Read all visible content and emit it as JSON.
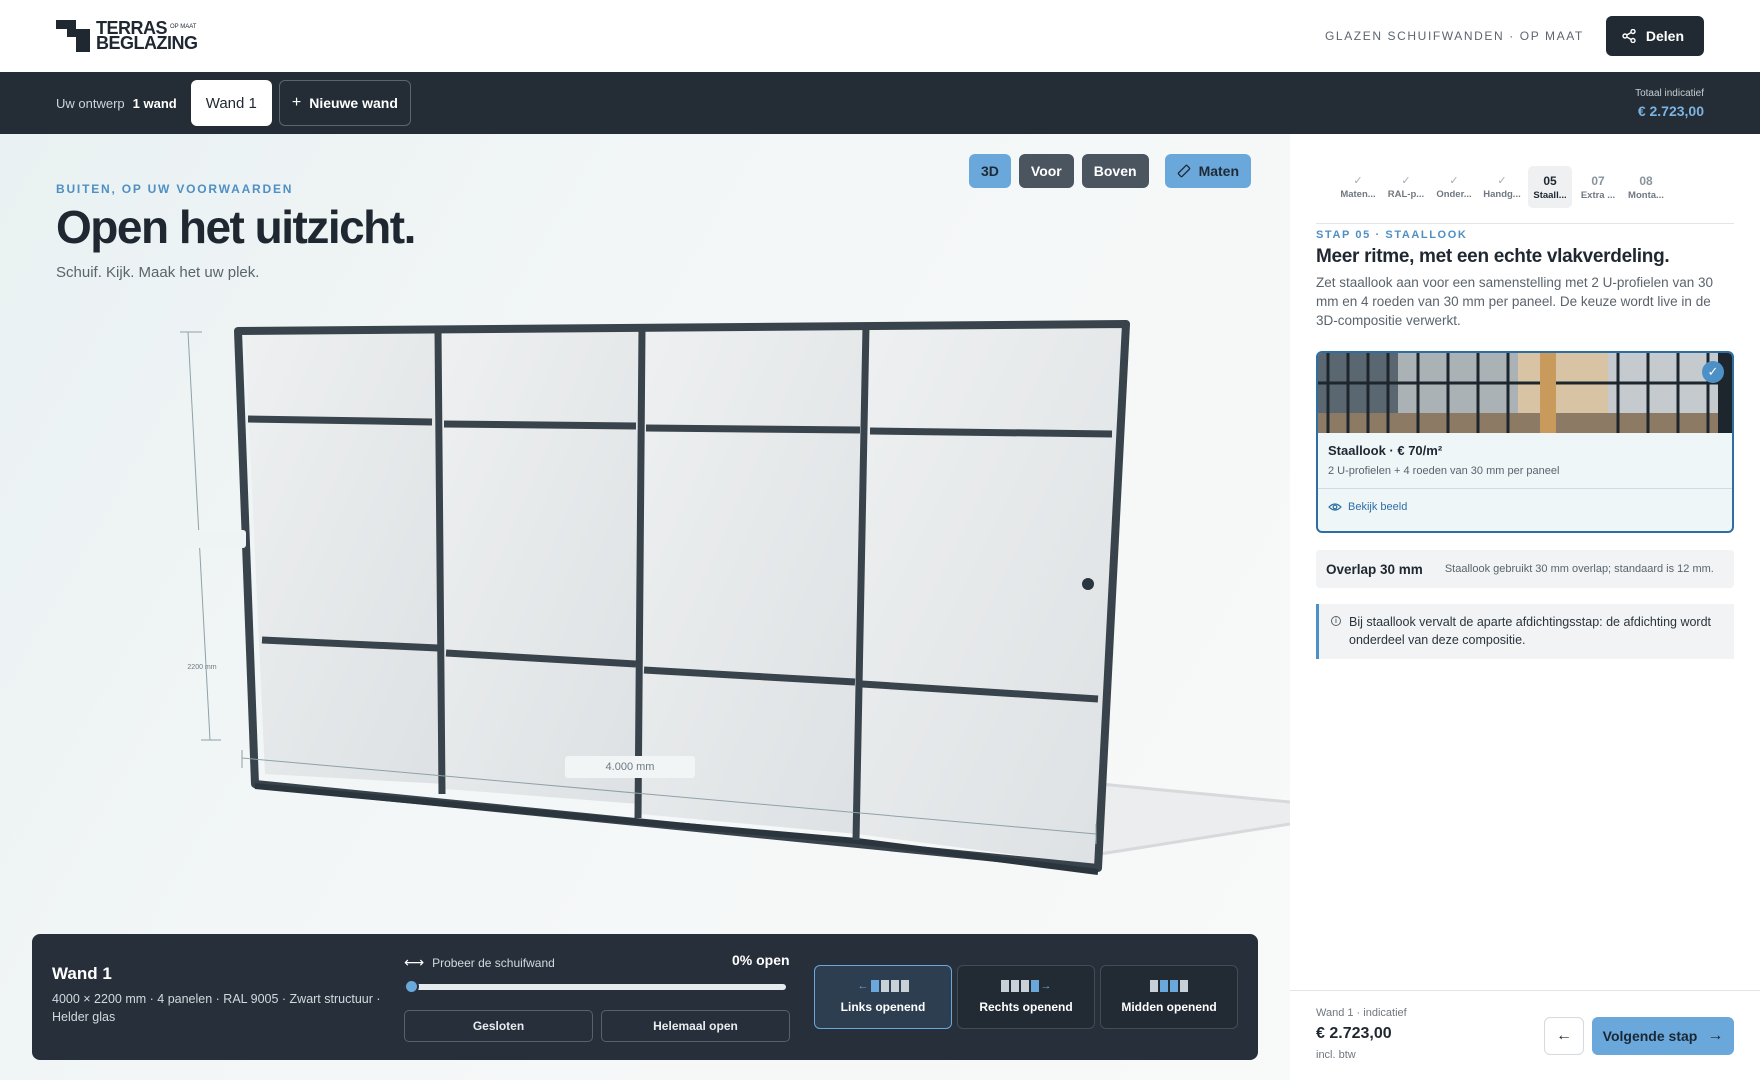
{
  "brand": {
    "line1": "TERRAS",
    "tiny": "OP MAAT",
    "line2": "BEGLAZING"
  },
  "header": {
    "tagline": "GLAZEN SCHUIFWANDEN · OP MAAT",
    "share_label": "Delen"
  },
  "designbar": {
    "label": "Uw ontwerp",
    "count": "1 wand",
    "active_tab": "Wand 1",
    "new_tab": "Nieuwe wand",
    "total_label": "Totaal indicatief",
    "total_value": "€ 2.723,00"
  },
  "canvas": {
    "eyebrow": "BUITEN, OP UW VOORWAARDEN",
    "hero": "Open het uitzicht.",
    "sub": "Schuif. Kijk. Maak het uw plek.",
    "views": [
      "3D",
      "Voor",
      "Boven"
    ],
    "active_view": "3D",
    "measure_label": "Maten",
    "dim_height": "2200 mm",
    "dim_width": "4.000 mm"
  },
  "panel": {
    "title": "Wand 1",
    "desc": "4000 × 2200 mm · 4 panelen · RAL 9005 · Zwart structuur · Helder glas",
    "try_label": "Probeer de schuifwand",
    "open_pct": "0% open",
    "open_fraction": 0,
    "btn_closed": "Gesloten",
    "btn_open": "Helemaal open",
    "modes": [
      "Links openend",
      "Rechts openend",
      "Midden openend"
    ],
    "active_mode": "Links openend"
  },
  "sidebar": {
    "steps": [
      {
        "num": "",
        "label": "Maten...",
        "done": true
      },
      {
        "num": "",
        "label": "RAL-p...",
        "done": true
      },
      {
        "num": "",
        "label": "Onder...",
        "done": true
      },
      {
        "num": "",
        "label": "Handg...",
        "done": true
      },
      {
        "num": "05",
        "label": "Staall...",
        "done": false,
        "current": true
      },
      {
        "num": "07",
        "label": "Extra ...",
        "done": false
      },
      {
        "num": "08",
        "label": "Monta...",
        "done": false
      }
    ],
    "eyebrow": "STAP 05 · STAALLOOK",
    "title": "Meer ritme, met een echte vlakverdeling.",
    "text": "Zet staallook aan voor een samenstelling met 2 U-profielen van 30 mm en 4 roeden van 30 mm per paneel. De keuze wordt live in de 3D-compositie verwerkt.",
    "option": {
      "title": "Staallook · € 70/m²",
      "sub": "2 U-profielen + 4 roeden van 30 mm per paneel",
      "link": "Bekijk beeld"
    },
    "overlap": {
      "title": "Overlap 30 mm",
      "text": "Staallook gebruikt 30 mm overlap; standaard is 12 mm."
    },
    "note": "Bij staallook vervalt de aparte afdichtingsstap: de afdichting wordt onderdeel van deze compositie."
  },
  "footer": {
    "label": "Wand 1 · indicatief",
    "price": "€ 2.723,00",
    "vat": "incl. btw",
    "next": "Volgende stap"
  },
  "colors": {
    "accent": "#6aa7da",
    "dark": "#242d36",
    "frame": "#39444d",
    "link": "#2f6ea3"
  }
}
